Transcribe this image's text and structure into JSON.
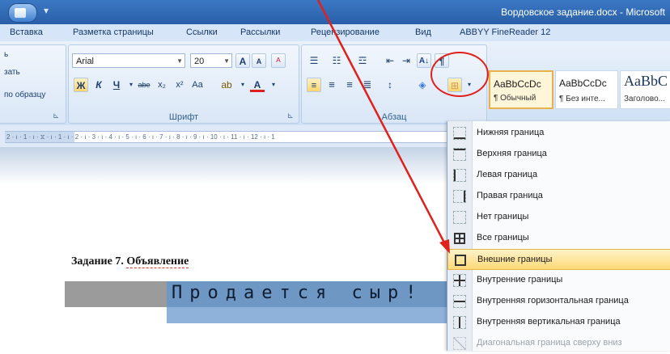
{
  "window": {
    "title": "Вордовское задание.docx - Microsoft"
  },
  "menu": {
    "tabs": [
      "Вставка",
      "Разметка страницы",
      "Ссылки",
      "Рассылки",
      "Рецензирование",
      "Вид",
      "ABBYY FineReader 12"
    ]
  },
  "ribbon": {
    "clipboard": {
      "line1": "ь",
      "line2": "зать",
      "line3": "по образцу"
    },
    "font": {
      "name": "Arial",
      "size": "20",
      "group_label": "Шрифт",
      "bold": "Ж",
      "italic": "К",
      "underline": "Ч",
      "strike": "abe",
      "subscript": "x₂",
      "superscript": "x²",
      "change_case": "Aa",
      "grow": "A",
      "shrink": "A",
      "clear": "ᴬ"
    },
    "paragraph": {
      "group_label": "Абзац",
      "pilcrow": "¶",
      "sort": "A↓"
    },
    "styles": [
      {
        "sample": "AaBbCcDc",
        "name": "¶ Обычный"
      },
      {
        "sample": "AaBbCcDc",
        "name": "¶ Без инте..."
      },
      {
        "sample": "AaBbC",
        "name": "Заголово..."
      }
    ]
  },
  "ruler": {
    "text": "2 · ı · 1 · ı · ⧖ · ı · 1 · ı · 2 · ı · 3 · ı · 4 · ı · 5 · ı · 6 · ı · 7 · ı · 8 · ı · 9 · ı · 10 · ı · 11 · ı · 12 · ı · 1"
  },
  "document": {
    "task_prefix": "Задание 7. ",
    "task_word": "Объявление",
    "banner": "Продается сыр!"
  },
  "border_menu": {
    "items": [
      {
        "label": "Нижняя граница",
        "icon": "border-bottom-icon"
      },
      {
        "label": "Верхняя граница",
        "icon": "border-top-icon"
      },
      {
        "label": "Левая граница",
        "icon": "border-left-icon"
      },
      {
        "label": "Правая граница",
        "icon": "border-right-icon"
      },
      {
        "label": "Нет границы",
        "icon": "border-none-icon"
      },
      {
        "label": "Все границы",
        "icon": "border-all-icon"
      },
      {
        "label": "Внешние границы",
        "icon": "border-outside-icon",
        "highlighted": true
      },
      {
        "label": "Внутренние границы",
        "icon": "border-inside-icon"
      },
      {
        "label": "Внутренняя горизонтальная граница",
        "icon": "border-inside-horizontal-icon"
      },
      {
        "label": "Внутренняя вертикальная граница",
        "icon": "border-inside-vertical-icon"
      },
      {
        "label": "Диагональная граница сверху вниз",
        "icon": "border-diagonal-down-icon",
        "disabled": true
      }
    ]
  },
  "colors": {
    "annotation": "#e0201a",
    "hover": "#ffd977",
    "titlebar": "#2a5fa8"
  }
}
